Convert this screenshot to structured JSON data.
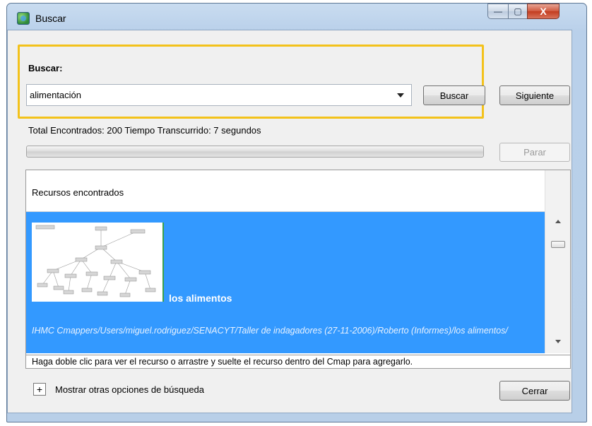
{
  "window": {
    "title": "Buscar",
    "controls": {
      "minimize": "—",
      "maximize": "▢",
      "close": "X"
    }
  },
  "search": {
    "label": "Buscar:",
    "query": "alimentación",
    "search_button": "Buscar",
    "next_button": "Siguiente"
  },
  "status": {
    "summary": "Total Encontrados: 200 Tiempo Transcurrido: 7 segundos",
    "stop_button": "Parar"
  },
  "results": {
    "header": "Recursos encontrados",
    "items": [
      {
        "title": "los alimentos",
        "path": "IHMC Cmappers/Users/miguel.rodriguez/SENACYT/Taller de indagadores (27-11-2006)/Roberto (Informes)/los alimentos/"
      }
    ]
  },
  "hint": "Haga doble clic para ver el recurso o arrastre y suelte el recurso dentro del Cmap para agregarlo.",
  "footer": {
    "expander_symbol": "+",
    "more_options": "Mostrar otras opciones de búsqueda",
    "close_button": "Cerrar"
  },
  "colors": {
    "selection": "#3399ff",
    "highlight_border": "#f3c21b"
  }
}
